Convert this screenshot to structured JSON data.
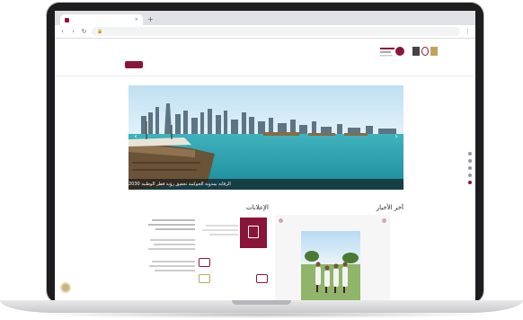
{
  "browser": {
    "tab_title": "",
    "url": ""
  },
  "site": {
    "top_nav": [
      "",
      "",
      "",
      ""
    ],
    "sub_nav": [
      "",
      "",
      "",
      "",
      ""
    ],
    "lang": "",
    "search_label": ""
  },
  "hero": {
    "caption": "الرقابة بمدونة الحوكمة تحقيق رؤية قطر الوطنية 2030"
  },
  "sections": {
    "latest_news": "آخر الأخبار",
    "announcements": "الإعلانات"
  },
  "colors": {
    "brand": "#8a1538"
  }
}
